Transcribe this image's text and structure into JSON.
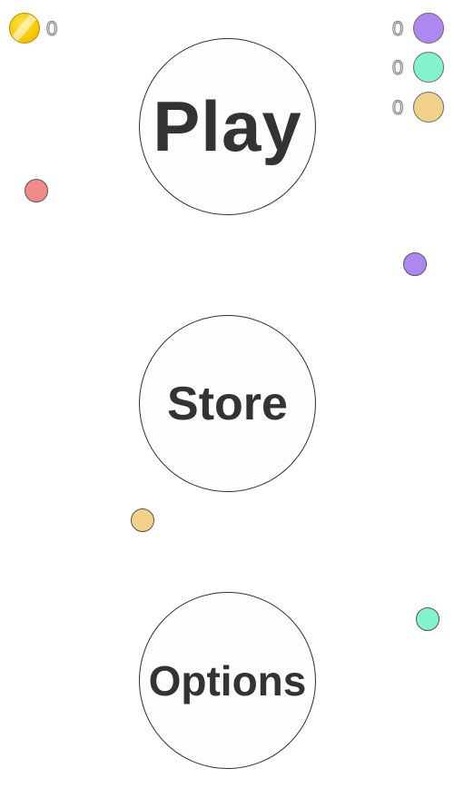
{
  "hud": {
    "coins": "0",
    "gems": [
      {
        "color": "purple",
        "hex": "#ad88f3",
        "count": "0"
      },
      {
        "color": "green",
        "hex": "#84f3cd",
        "count": "0"
      },
      {
        "color": "orange",
        "hex": "#f3d18a",
        "count": "0"
      }
    ]
  },
  "menu": {
    "play_label": "Play",
    "store_label": "Store",
    "options_label": "Options"
  },
  "dots": [
    {
      "color": "red",
      "hex": "#f08a8a"
    },
    {
      "color": "purple",
      "hex": "#ad88f3"
    },
    {
      "color": "orange",
      "hex": "#f3d18a"
    },
    {
      "color": "teal",
      "hex": "#84f3cd"
    }
  ]
}
